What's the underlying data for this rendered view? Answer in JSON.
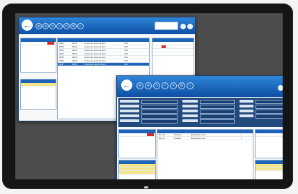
{
  "window_back": {
    "back_glyph": "←",
    "toolbar_icons": [
      "⊕",
      "⊖",
      "↻",
      "✓",
      "✕",
      "⚙",
      "⌂"
    ],
    "grid_rows": [
      {
        "c1": "0001",
        "c2": "01/06",
        "c3": "Customer account item",
        "c4": "0.00"
      },
      {
        "c1": "0002",
        "c2": "01/06",
        "c3": "Customer account item",
        "c4": "0.00"
      },
      {
        "c1": "0003",
        "c2": "02/06",
        "c3": "Customer account item",
        "c4": "0.00"
      },
      {
        "c1": "0004",
        "c2": "02/06",
        "c3": "Customer account item",
        "c4": "0.00"
      },
      {
        "c1": "0005",
        "c2": "03/06",
        "c3": "Customer account item",
        "c4": "0.00"
      },
      {
        "c1": "0006",
        "c2": "03/06",
        "c3": "Customer account item",
        "c4": "0.00"
      },
      {
        "c1": "0007",
        "c2": "04/06",
        "c3": "Customer account item",
        "c4": "0.00"
      }
    ]
  },
  "window_front": {
    "back_glyph": "←",
    "toolbar_icons": [
      "⊕",
      "⊖",
      "↻",
      "✓",
      "✕",
      "⚙",
      "⌂"
    ],
    "grid_rows": [
      {
        "c1": "Ref 10",
        "c2": "Product",
        "c3": "Description line",
        "c4": "1"
      },
      {
        "c1": "Ref 11",
        "c2": "Product",
        "c3": "Description line",
        "c4": "1"
      }
    ]
  },
  "colors": {
    "toolbar": "#0d4fa3",
    "selection": "#1d64b8",
    "flag": "#d62b2b",
    "highlight": "#f3e58c"
  }
}
